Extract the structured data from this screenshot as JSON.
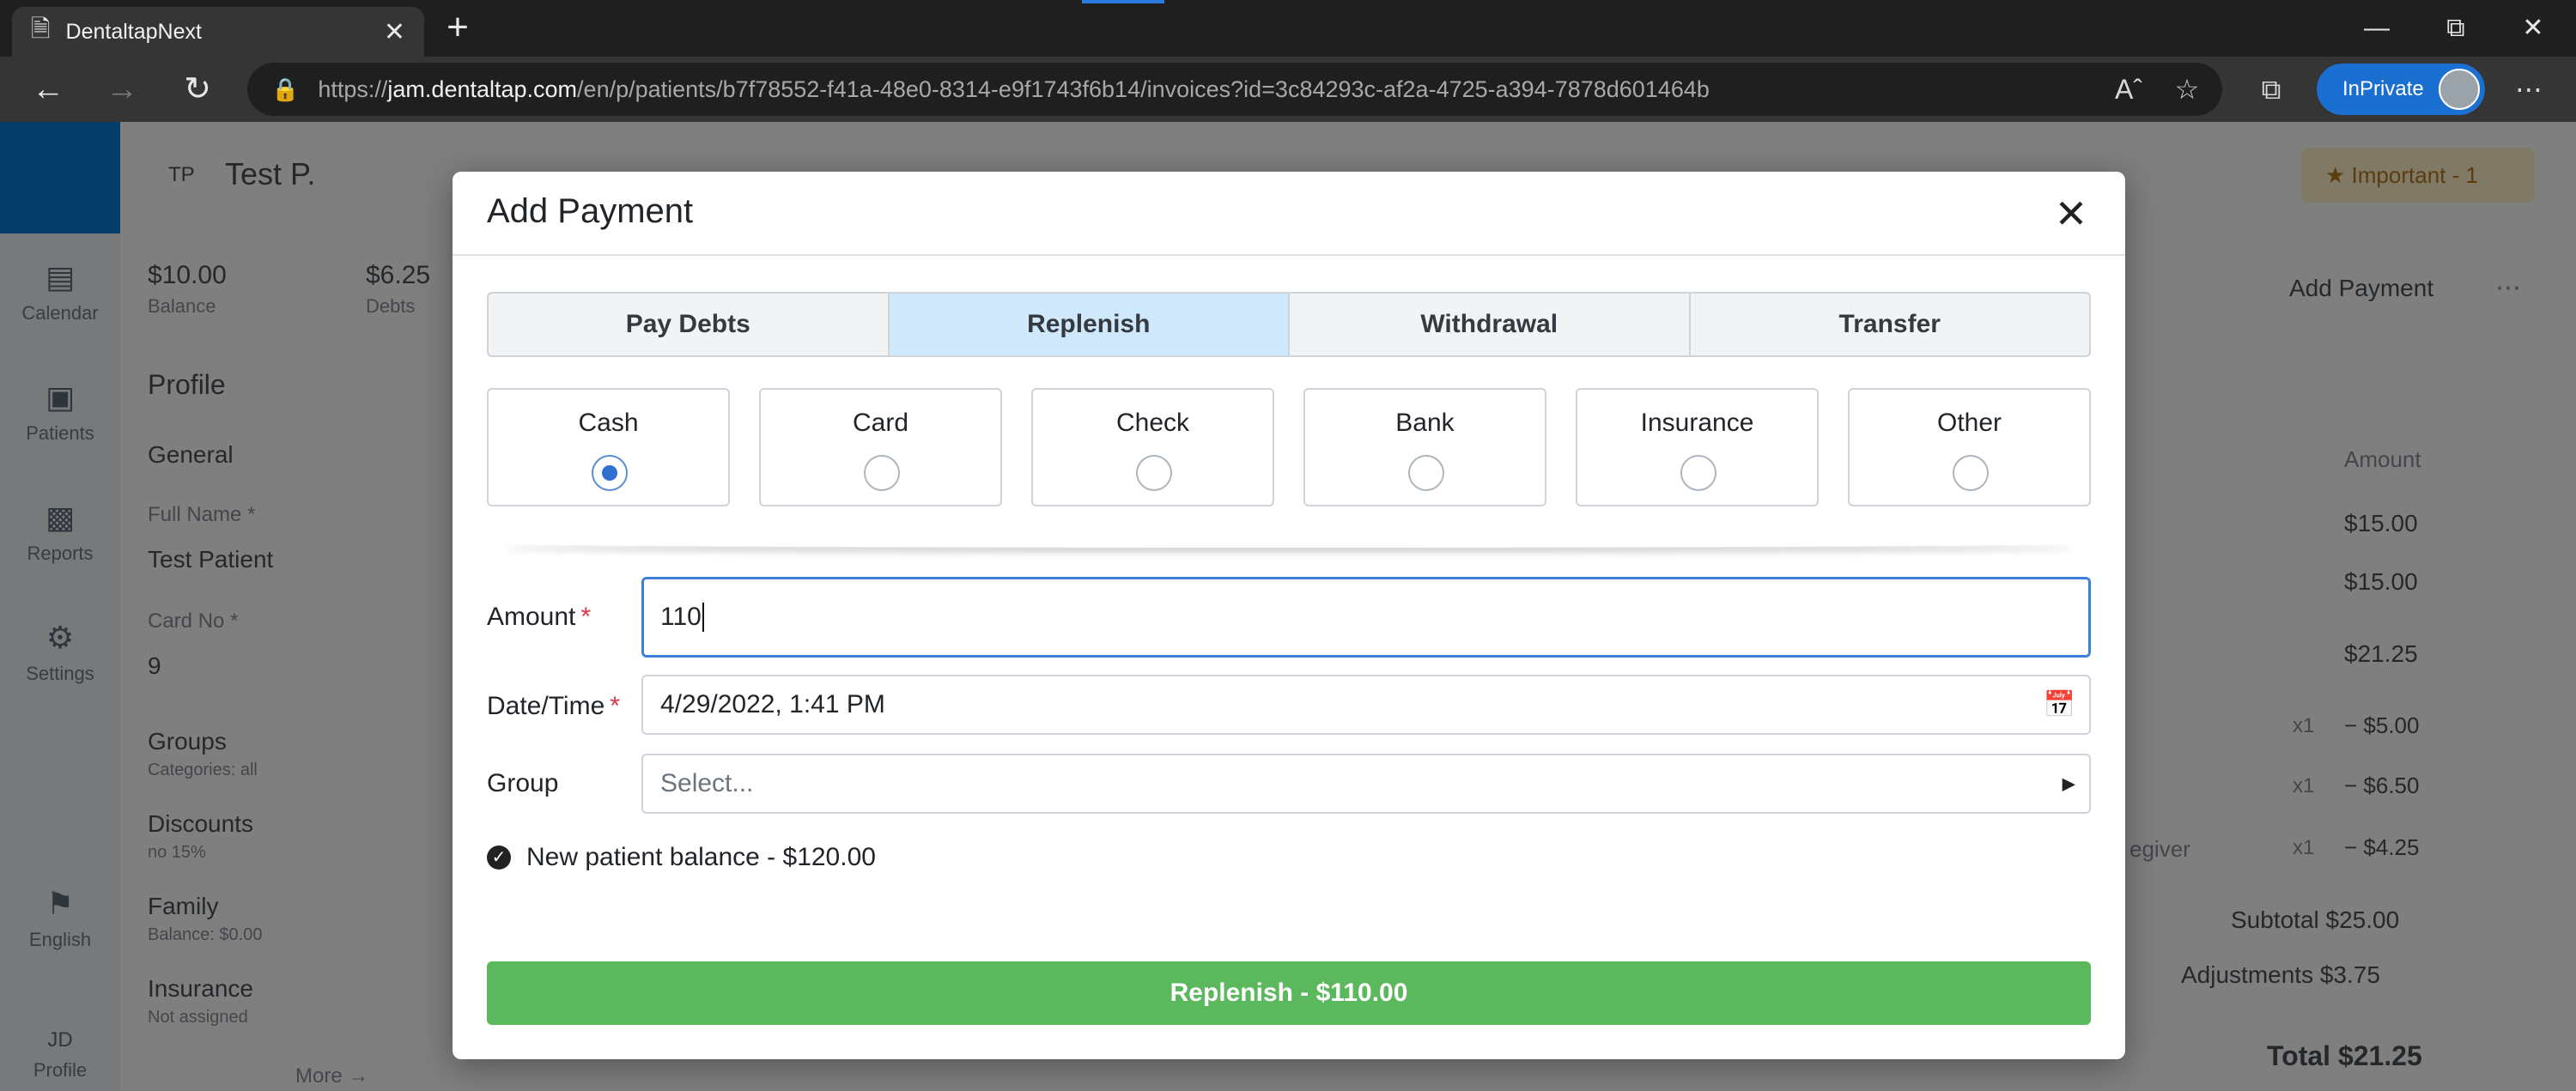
{
  "browser": {
    "tab_title": "DentaltapNext",
    "url_prefix": "https://",
    "url_host": "jam.dentaltap.com",
    "url_path": "/en/p/patients/b7f78552-f41a-48e0-8314-e9f1743f6b14/invoices?id=3c84293c-af2a-4725-a394-7878d601464b",
    "inprivate_label": "InPrivate"
  },
  "background": {
    "header_initials": "TP",
    "header_name": "Test P.",
    "balance_value": "$10.00",
    "balance_label": "Balance",
    "debts_value": "$6.25",
    "debts_label": "Debts",
    "important_label": "Important - 1",
    "rail": {
      "calendar": "Calendar",
      "patients": "Patients",
      "reports": "Reports",
      "settings": "Settings",
      "language": "English",
      "profile_initials": "JD",
      "profile": "Profile"
    },
    "profile_heading": "Profile",
    "general_heading": "General",
    "full_name_label": "Full Name *",
    "full_name_value": "Test Patient",
    "card_no_label": "Card No *",
    "card_no_value": "9",
    "groups_label": "Groups",
    "groups_value": "Categories: all",
    "discounts_label": "Discounts",
    "discounts_value": "no 15%",
    "family_label": "Family",
    "family_value": "Balance: $0.00",
    "insurance_label": "Insurance",
    "insurance_value": "Not assigned",
    "more_link": "More →",
    "add_payment_link": "Add Payment",
    "amount_col": "Amount",
    "amounts": [
      "$15.00",
      "$15.00",
      "$21.25"
    ],
    "qty": [
      "x1",
      "x1",
      "x1"
    ],
    "discount_amounts": [
      "− $5.00",
      "− $6.50",
      "− $4.25"
    ],
    "caregiver_fragment": "egiver",
    "subtotal": "Subtotal $25.00",
    "adjustments": "Adjustments $3.75",
    "total": "Total $21.25"
  },
  "modal": {
    "title": "Add Payment",
    "tabs": [
      {
        "label": "Pay Debts",
        "active": false
      },
      {
        "label": "Replenish",
        "active": true
      },
      {
        "label": "Withdrawal",
        "active": false
      },
      {
        "label": "Transfer",
        "active": false
      }
    ],
    "methods": [
      {
        "label": "Cash",
        "checked": true
      },
      {
        "label": "Card",
        "checked": false
      },
      {
        "label": "Check",
        "checked": false
      },
      {
        "label": "Bank",
        "checked": false
      },
      {
        "label": "Insurance",
        "checked": false
      },
      {
        "label": "Other",
        "checked": false
      }
    ],
    "amount_label": "Amount",
    "amount_value": "110",
    "datetime_label": "Date/Time",
    "datetime_value": "4/29/2022, 1:41 PM",
    "group_label": "Group",
    "group_placeholder": "Select...",
    "required_mark": "*",
    "balance_note": "New patient balance - $120.00",
    "submit_label": "Replenish - $110.00"
  },
  "colors": {
    "active_tab": "#d0e8fb",
    "submit": "#5cb85c",
    "required": "#dc3545",
    "radio_checked": "#2f6fd0"
  }
}
